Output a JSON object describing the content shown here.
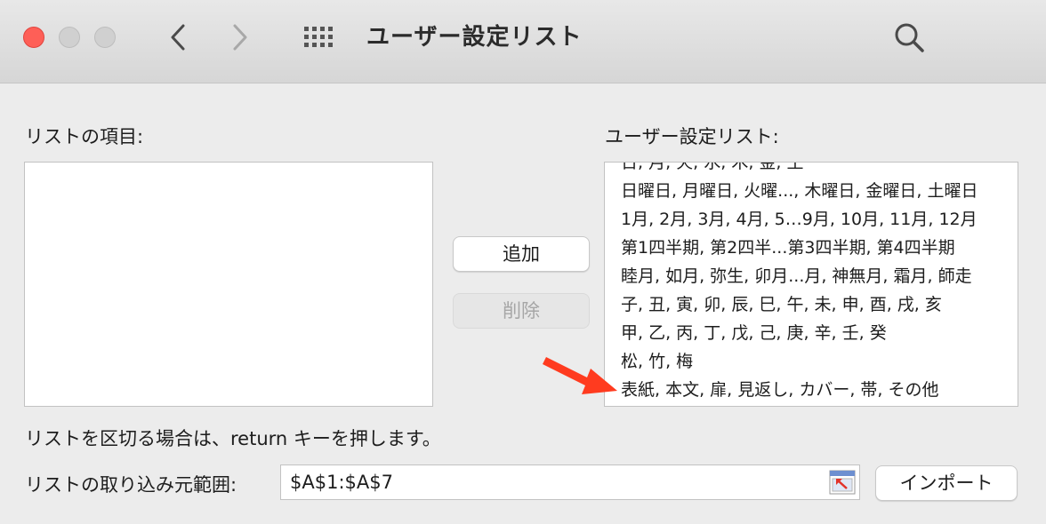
{
  "window": {
    "title": "ユーザー設定リスト"
  },
  "labels": {
    "list_items": "リストの項目:",
    "user_lists": "ユーザー設定リスト:",
    "hint": "リストを区切る場合は、return キーを押します。",
    "import_range": "リストの取り込み元範囲:"
  },
  "user_lists": [
    "日, 月, 火, 水, 木, 金, 土",
    "日曜日, 月曜日, 火曜..., 木曜日, 金曜日, 土曜日",
    "1月, 2月, 3月, 4月, 5…9月, 10月, 11月, 12月",
    "第1四半期, 第2四半...第3四半期, 第4四半期",
    "睦月, 如月, 弥生, 卯月...月, 神無月, 霜月, 師走",
    "子, 丑, 寅, 卯, 辰, 巳, 午, 未, 申, 酉, 戌, 亥",
    "甲, 乙, 丙, 丁, 戊, 己, 庚, 辛, 壬, 癸",
    "松, 竹, 梅",
    "表紙, 本文, 扉, 見返し, カバー, 帯, その他"
  ],
  "buttons": {
    "add": "追加",
    "delete": "削除",
    "import": "インポート"
  },
  "range_input": {
    "value": "$A$1:$A$7"
  },
  "icons": {
    "back": "chevron-left-icon",
    "forward": "chevron-right-icon",
    "grid": "grid-icon",
    "search": "search-icon",
    "collapse": "collapse-dialog-icon",
    "arrow": "red-arrow-annotation"
  },
  "colors": {
    "close": "#fe5f57",
    "arrow": "#ff3b1f",
    "background": "#ececec"
  }
}
